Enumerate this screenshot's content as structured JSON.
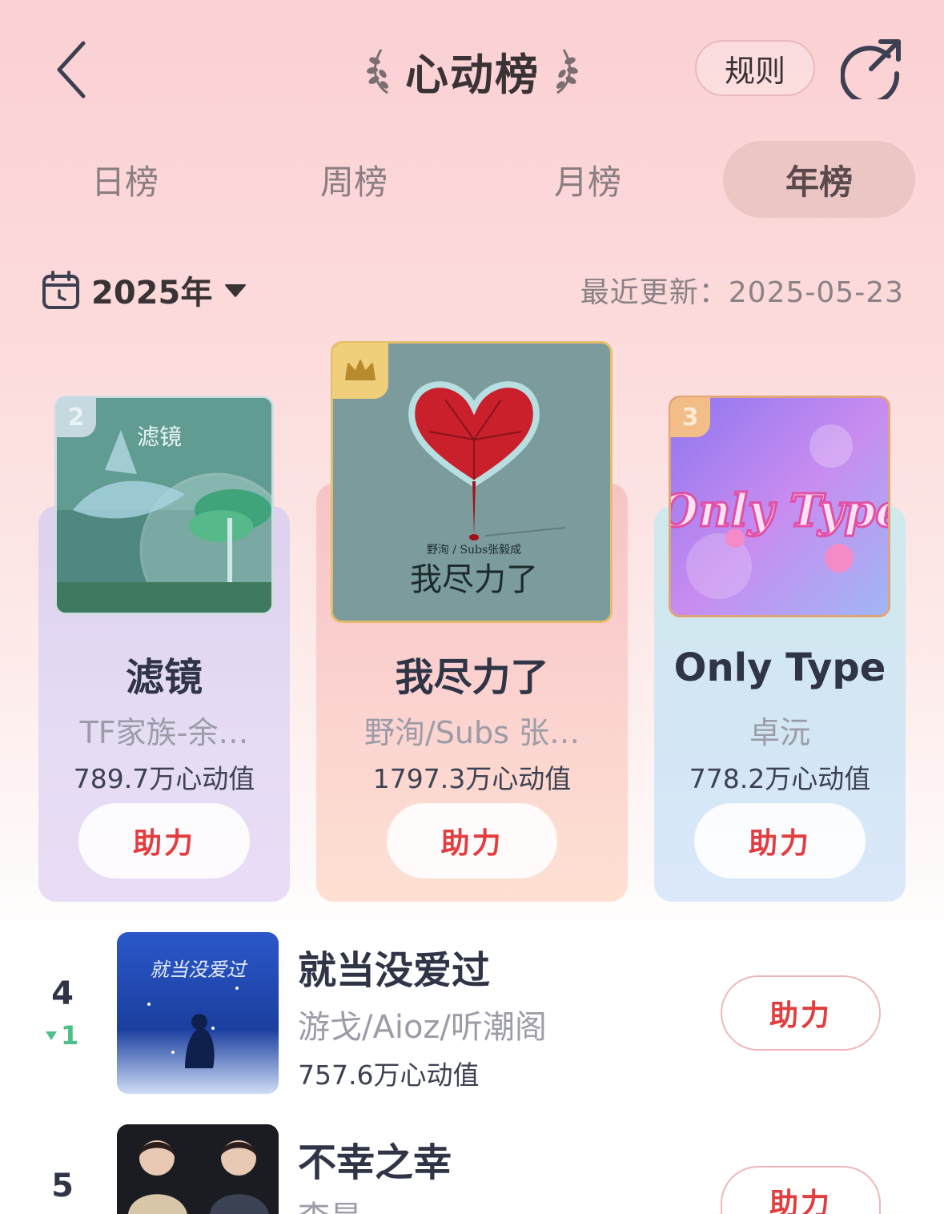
{
  "header": {
    "title": "心动榜",
    "rules_label": "规则"
  },
  "tabs": [
    {
      "label": "日榜",
      "active": false
    },
    {
      "label": "周榜",
      "active": false
    },
    {
      "label": "月榜",
      "active": false
    },
    {
      "label": "年榜",
      "active": true
    }
  ],
  "filter": {
    "year": "2025年",
    "updated": "最近更新：2025-05-23"
  },
  "podium": [
    {
      "rank": "1",
      "title": "我尽力了",
      "artist": "野洵/Subs 张…",
      "score": "1797.3万心动值",
      "button": "助力",
      "cover_text": "我尽力了",
      "cover_subtext": "野洵 / Subs张毅成"
    },
    {
      "rank": "2",
      "title": "滤镜",
      "artist": "TF家族-余…",
      "score": "789.7万心动值",
      "button": "助力",
      "cover_text": "滤镜"
    },
    {
      "rank": "3",
      "title": "Only Type",
      "artist": "卓沅",
      "score": "778.2万心动值",
      "button": "助力",
      "cover_text": "Only Type"
    }
  ],
  "list": [
    {
      "rank": "4",
      "change": "1",
      "change_direction": "down",
      "title": "就当没爱过",
      "artist": "游戈/Aioz/听潮阁",
      "score": "757.6万心动值",
      "button": "助力",
      "cover_text": "就当没爱过"
    },
    {
      "rank": "5",
      "title": "不幸之幸",
      "artist": "李昊",
      "button": "助力"
    }
  ],
  "colors": {
    "accent_red": "#e23d3f",
    "rank_up_green": "#4fbf8a",
    "gold_badge": "#f0cf7a",
    "silver_badge": "#c6d8e0",
    "bronze_badge": "#f3bd87"
  }
}
